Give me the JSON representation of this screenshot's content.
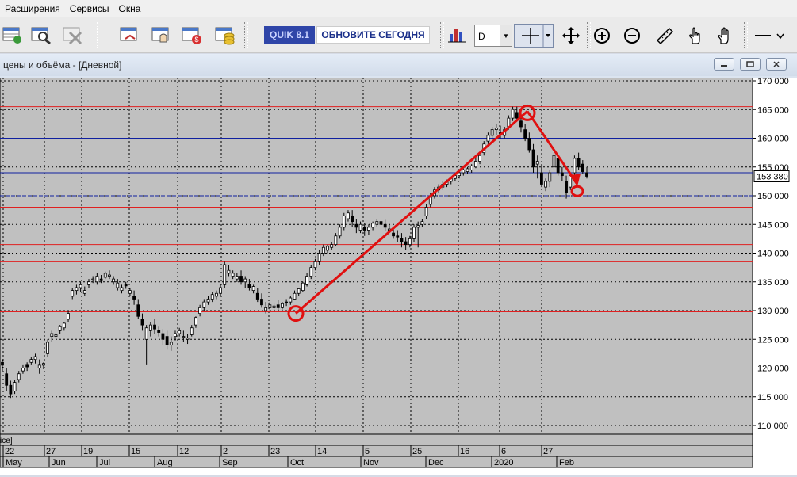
{
  "menu": {
    "items": [
      "Расширения",
      "Сервисы",
      "Окна"
    ]
  },
  "toolbar": {
    "quik_badge": "QUIK 8.1",
    "update_label": "ОБНОВИТЕ СЕГОДНЯ",
    "interval_value": "D",
    "icons": [
      "orders-table-icon",
      "search-table-icon",
      "delete-table-icon",
      "deals-table-icon",
      "portfolio-table-icon",
      "money-table-icon",
      "coins-table-icon",
      "bar-chart-icon",
      "crosshair-icon",
      "move-icon",
      "zoom-in-icon",
      "zoom-out-icon",
      "ruler-icon",
      "hand-pointer-icon",
      "hand-grab-icon",
      "line-style-icon"
    ]
  },
  "window": {
    "title": "цены и объёма - [Дневной]",
    "buttons": [
      "minimize",
      "restore",
      "close"
    ]
  },
  "chart_data": {
    "type": "candlestick",
    "title": "",
    "panel_label": "ice]",
    "y_ticks": [
      "170 000",
      "165 000",
      "160 000",
      "155 000",
      "150 000",
      "145 000",
      "140 000",
      "135 000",
      "130 000",
      "125 000",
      "120 000",
      "115 000",
      "110 000"
    ],
    "ylim": [
      110000,
      170000
    ],
    "last_price_label": "153 380",
    "last_price": 153380,
    "date_ticks": [
      "22",
      "27",
      "19",
      "15",
      "12",
      "2",
      "23",
      "14",
      "5",
      "25",
      "16",
      "6",
      "27"
    ],
    "month_labels": [
      "May",
      "Jun",
      "Jul",
      "Aug",
      "Sep",
      "Oct",
      "Nov",
      "Dec",
      "2020",
      "Feb"
    ],
    "red_levels": [
      165500,
      148000,
      141500,
      138500,
      129800
    ],
    "blue_levels": [
      160000,
      154000,
      150000
    ],
    "series": [
      {
        "values": [
          [
            121000,
            121500,
            119500,
            120500
          ],
          [
            119000,
            120000,
            116000,
            117000
          ],
          [
            117000,
            117800,
            114800,
            115500
          ],
          [
            116000,
            118000,
            115500,
            117500
          ],
          [
            118000,
            119500,
            117500,
            119000
          ],
          [
            119500,
            120500,
            119000,
            120000
          ],
          [
            120500,
            121000,
            119500,
            120200
          ],
          [
            121000,
            122000,
            120500,
            121500
          ],
          [
            121500,
            122500,
            120800,
            122000
          ],
          [
            120000,
            121500,
            119000,
            120500
          ],
          [
            120500,
            121000,
            119800,
            120800
          ],
          [
            122500,
            125000,
            122000,
            124500
          ],
          [
            125500,
            126500,
            124500,
            126000
          ],
          [
            125500,
            126200,
            125000,
            125800
          ],
          [
            126500,
            127500,
            126000,
            127200
          ],
          [
            127000,
            128000,
            126500,
            127800
          ],
          [
            128500,
            130000,
            128000,
            129500
          ],
          [
            132500,
            134000,
            132000,
            133500
          ],
          [
            133500,
            134500,
            132800,
            134000
          ],
          [
            134000,
            135000,
            133200,
            134500
          ],
          [
            133000,
            134200,
            132500,
            133500
          ],
          [
            134500,
            135500,
            134000,
            135000
          ],
          [
            135500,
            136000,
            134800,
            135500
          ],
          [
            135000,
            136500,
            134500,
            136000
          ],
          [
            135500,
            136200,
            134800,
            135200
          ],
          [
            135800,
            136800,
            135500,
            136500
          ],
          [
            136000,
            137000,
            135500,
            136200
          ],
          [
            135000,
            136000,
            134500,
            135500
          ],
          [
            134000,
            135500,
            133500,
            134800
          ],
          [
            133500,
            134500,
            133000,
            134000
          ],
          [
            134500,
            135000,
            133800,
            134300
          ],
          [
            133000,
            134000,
            132500,
            133500
          ],
          [
            132500,
            133500,
            131000,
            132000
          ],
          [
            131000,
            132000,
            128500,
            129000
          ],
          [
            128500,
            129500,
            126500,
            127500
          ],
          [
            125000,
            127500,
            120500,
            127000
          ],
          [
            126500,
            128000,
            125500,
            127500
          ],
          [
            127500,
            128500,
            126000,
            126800
          ],
          [
            126500,
            127200,
            125500,
            126200
          ],
          [
            126000,
            126800,
            124000,
            125000
          ],
          [
            125500,
            126500,
            123200,
            124000
          ],
          [
            124000,
            125500,
            123000,
            124500
          ],
          [
            125500,
            126500,
            124800,
            126000
          ],
          [
            126000,
            127000,
            125500,
            126500
          ],
          [
            125500,
            126500,
            124500,
            125500
          ],
          [
            125000,
            126000,
            124200,
            125200
          ],
          [
            125800,
            127500,
            125500,
            127000
          ],
          [
            127500,
            129000,
            127000,
            128800
          ],
          [
            129500,
            131000,
            129000,
            130500
          ],
          [
            130500,
            132000,
            130000,
            131500
          ],
          [
            131500,
            132500,
            131000,
            132000
          ],
          [
            132000,
            133200,
            131500,
            132800
          ],
          [
            132500,
            133500,
            132000,
            133000
          ],
          [
            133000,
            134500,
            132500,
            134000
          ],
          [
            134500,
            138500,
            134000,
            138000
          ],
          [
            136500,
            138000,
            136000,
            137000
          ],
          [
            136000,
            137000,
            135500,
            136500
          ],
          [
            135500,
            136500,
            135000,
            136000
          ],
          [
            136000,
            137000,
            134500,
            135000
          ],
          [
            135000,
            136000,
            134000,
            135500
          ],
          [
            134500,
            135500,
            133500,
            134000
          ],
          [
            133500,
            134500,
            133000,
            134200
          ],
          [
            133000,
            134000,
            131500,
            132000
          ],
          [
            132000,
            133000,
            130500,
            131000
          ],
          [
            130000,
            131500,
            129500,
            130500
          ],
          [
            130500,
            131500,
            130000,
            131000
          ],
          [
            130500,
            131200,
            129800,
            130800
          ],
          [
            131000,
            131800,
            130000,
            130500
          ],
          [
            130500,
            131500,
            130200,
            131200
          ],
          [
            131500,
            132000,
            130800,
            131300
          ],
          [
            131500,
            132500,
            131000,
            132200
          ],
          [
            132000,
            133500,
            131800,
            133000
          ],
          [
            133000,
            134000,
            132500,
            133800
          ],
          [
            133500,
            135000,
            133200,
            134800
          ],
          [
            134500,
            136500,
            134200,
            136000
          ],
          [
            136000,
            138000,
            135500,
            137500
          ],
          [
            137500,
            139000,
            137000,
            138500
          ],
          [
            138500,
            140500,
            138000,
            140000
          ],
          [
            140000,
            141500,
            139500,
            141000
          ],
          [
            140500,
            141500,
            140000,
            141200
          ],
          [
            141000,
            142000,
            140500,
            141500
          ],
          [
            141500,
            143500,
            141200,
            143000
          ],
          [
            143000,
            145000,
            142500,
            144500
          ],
          [
            144500,
            147000,
            144000,
            146500
          ],
          [
            146000,
            147500,
            145500,
            147000
          ],
          [
            146500,
            147500,
            144500,
            145500
          ],
          [
            145000,
            146000,
            143500,
            144500
          ],
          [
            144000,
            145500,
            143500,
            145000
          ],
          [
            144500,
            145200,
            143000,
            144000
          ],
          [
            144000,
            145000,
            143200,
            144500
          ],
          [
            144500,
            145500,
            144000,
            145200
          ],
          [
            145000,
            146000,
            144500,
            145500
          ],
          [
            145500,
            146500,
            144800,
            145000
          ],
          [
            145000,
            145800,
            143800,
            144500
          ],
          [
            144000,
            145000,
            143500,
            144200
          ],
          [
            143500,
            144500,
            142500,
            143000
          ],
          [
            143000,
            144000,
            142000,
            142800
          ],
          [
            142500,
            143500,
            141000,
            142000
          ],
          [
            142000,
            142800,
            140500,
            141500
          ],
          [
            141500,
            143000,
            141000,
            142500
          ],
          [
            142500,
            145000,
            142000,
            144500
          ],
          [
            144500,
            145500,
            141000,
            144800
          ],
          [
            145000,
            146000,
            144500,
            145500
          ],
          [
            146500,
            148500,
            146000,
            148000
          ],
          [
            148500,
            150500,
            148000,
            150000
          ],
          [
            150000,
            151500,
            149500,
            151000
          ],
          [
            151000,
            152000,
            150500,
            151500
          ],
          [
            151500,
            152500,
            151000,
            152000
          ],
          [
            152000,
            152800,
            151500,
            152500
          ],
          [
            152500,
            153200,
            152000,
            153000
          ],
          [
            153000,
            153800,
            152500,
            153500
          ],
          [
            153500,
            154200,
            153000,
            154000
          ],
          [
            154000,
            154800,
            153500,
            154500
          ],
          [
            154200,
            155000,
            153800,
            154700
          ],
          [
            154500,
            155500,
            154000,
            155200
          ],
          [
            155000,
            156500,
            154800,
            156000
          ],
          [
            156000,
            157500,
            155500,
            157000
          ],
          [
            157500,
            159500,
            157000,
            159000
          ],
          [
            159500,
            161000,
            159000,
            160500
          ],
          [
            160500,
            162000,
            160000,
            161500
          ],
          [
            161500,
            162500,
            160500,
            161800
          ],
          [
            161000,
            162200,
            160000,
            160800
          ],
          [
            160500,
            162000,
            160000,
            161500
          ],
          [
            162000,
            164000,
            161500,
            163500
          ],
          [
            163500,
            165500,
            163000,
            165000
          ],
          [
            164500,
            165500,
            163000,
            163500
          ],
          [
            163000,
            164000,
            161000,
            162000
          ],
          [
            161500,
            162500,
            159500,
            160000
          ],
          [
            160000,
            161000,
            157500,
            158000
          ],
          [
            158000,
            159000,
            154000,
            155000
          ],
          [
            155500,
            157000,
            153000,
            156000
          ],
          [
            154000,
            155500,
            151500,
            152000
          ],
          [
            151500,
            153000,
            150800,
            152500
          ],
          [
            152500,
            154500,
            151500,
            154000
          ],
          [
            155000,
            157500,
            154500,
            157000
          ],
          [
            156500,
            157200,
            153500,
            154000
          ],
          [
            154000,
            155000,
            152500,
            153500
          ],
          [
            152500,
            153500,
            149500,
            150500
          ],
          [
            151500,
            154000,
            151000,
            153500
          ],
          [
            154000,
            157000,
            153500,
            156500
          ],
          [
            156500,
            157500,
            154500,
            155000
          ],
          [
            155500,
            156200,
            153800,
            154200
          ],
          [
            154000,
            155000,
            153000,
            153380
          ]
        ]
      }
    ]
  }
}
